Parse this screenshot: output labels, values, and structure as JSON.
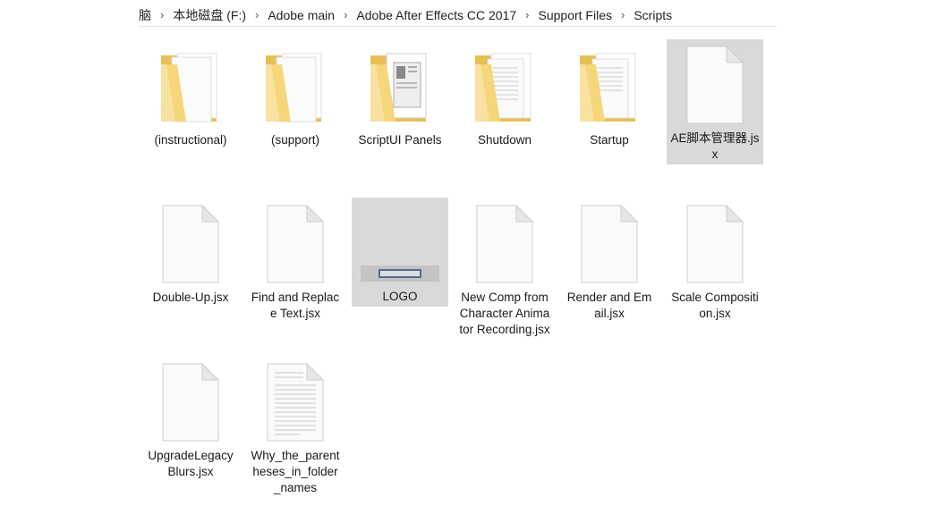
{
  "breadcrumb": [
    "脑",
    "本地磁盘 (F:)",
    "Adobe main",
    "Adobe After Effects CC 2017",
    "Support Files",
    "Scripts"
  ],
  "items": [
    {
      "label": "(instructional)",
      "kind": "folder",
      "icon": "folder-icon"
    },
    {
      "label": "(support)",
      "kind": "folder",
      "icon": "folder-icon"
    },
    {
      "label": "ScriptUI Panels",
      "kind": "folder",
      "icon": "folder-icon"
    },
    {
      "label": "Shutdown",
      "kind": "folder",
      "icon": "folder-icon"
    },
    {
      "label": "Startup",
      "kind": "folder",
      "icon": "folder-icon"
    },
    {
      "label": "AE脚本管理器.jsx",
      "kind": "file",
      "icon": "file-icon",
      "selected": true
    },
    {
      "label": "Double-Up.jsx",
      "kind": "file",
      "icon": "file-icon"
    },
    {
      "label": "Find and Replace Text.jsx",
      "kind": "file",
      "icon": "file-icon"
    },
    {
      "label": "LOGO",
      "kind": "image",
      "icon": "image-thumbnail-icon",
      "selected": true
    },
    {
      "label": "New Comp from Character Animator Recording.jsx",
      "kind": "file",
      "icon": "file-icon"
    },
    {
      "label": "Render and Email.jsx",
      "kind": "file",
      "icon": "file-icon"
    },
    {
      "label": "Scale Composition.jsx",
      "kind": "file",
      "icon": "file-icon"
    },
    {
      "label": "UpgradeLegacy Blurs.jsx",
      "kind": "file",
      "icon": "file-icon"
    },
    {
      "label": "Why_the_parentheses_in_folder_names",
      "kind": "text",
      "icon": "text-file-icon"
    }
  ],
  "colors": {
    "folder": "#f6d67a",
    "folder_dark": "#e8bf55",
    "selection": "#d9d9d9"
  }
}
